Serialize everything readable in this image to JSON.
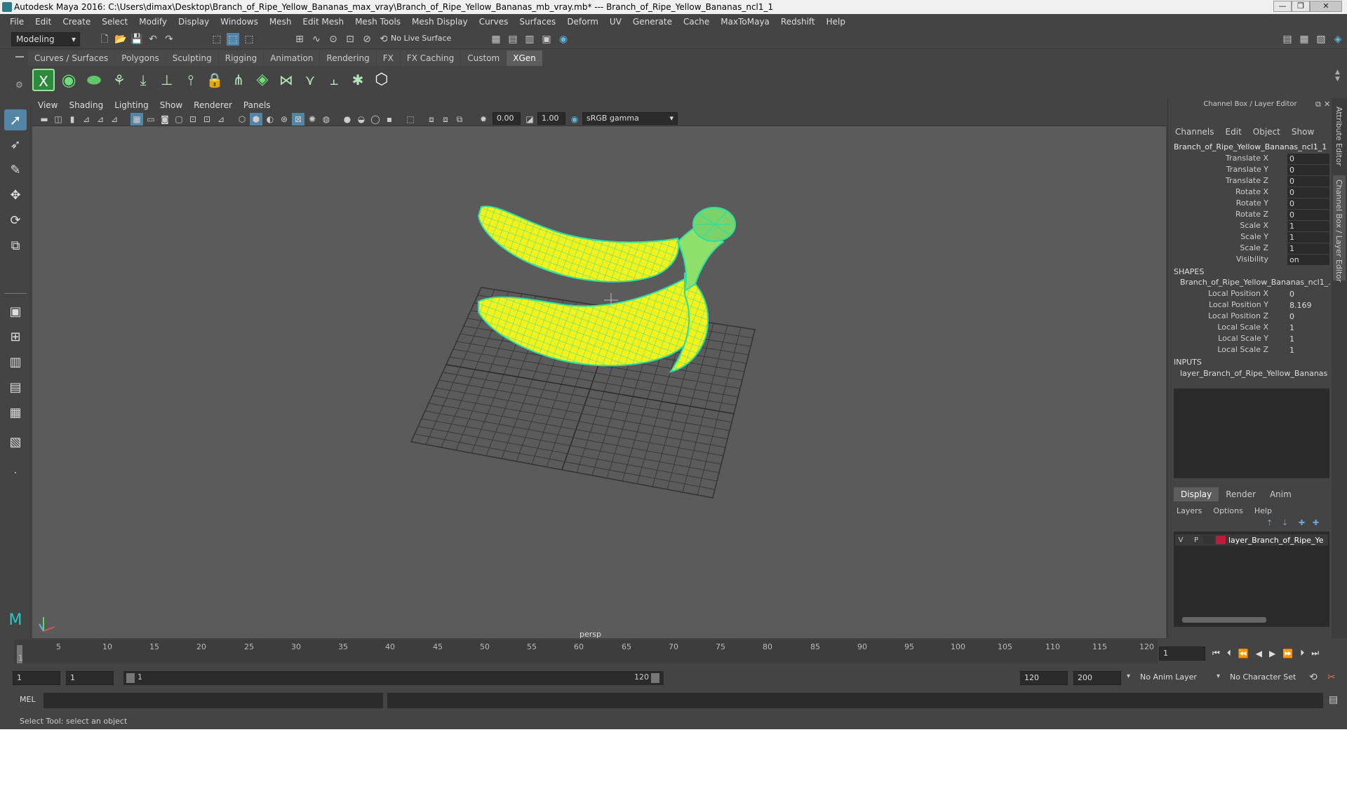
{
  "window": {
    "title": "Autodesk Maya 2016: C:\\Users\\dimax\\Desktop\\Branch_of_Ripe_Yellow_Bananas_max_vray\\Branch_of_Ripe_Yellow_Bananas_mb_vray.mb*   ---   Branch_of_Ripe_Yellow_Bananas_ncl1_1",
    "controls": [
      "—",
      "❐",
      "✕"
    ]
  },
  "menus": [
    "File",
    "Edit",
    "Create",
    "Select",
    "Modify",
    "Display",
    "Windows",
    "Mesh",
    "Edit Mesh",
    "Mesh Tools",
    "Mesh Display",
    "Curves",
    "Surfaces",
    "Deform",
    "UV",
    "Generate",
    "Cache",
    "MaxToMaya",
    "Redshift",
    "Help"
  ],
  "toolbar": {
    "mode": "Modeling",
    "live_surface": "No Live Surface"
  },
  "shelf_tabs": [
    {
      "label": "Curves / Surfaces",
      "active": false
    },
    {
      "label": "Polygons",
      "active": false
    },
    {
      "label": "Sculpting",
      "active": false
    },
    {
      "label": "Rigging",
      "active": false
    },
    {
      "label": "Animation",
      "active": false
    },
    {
      "label": "Rendering",
      "active": false
    },
    {
      "label": "FX",
      "active": false
    },
    {
      "label": "FX Caching",
      "active": false
    },
    {
      "label": "Custom",
      "active": false
    },
    {
      "label": "XGen",
      "active": true
    }
  ],
  "viewport": {
    "menus": [
      "View",
      "Shading",
      "Lighting",
      "Show",
      "Renderer",
      "Panels"
    ],
    "exposure": "0.00",
    "gamma": "1.00",
    "colorspace": "sRGB gamma",
    "camera": "persp"
  },
  "channel_box": {
    "header": "Channel Box / Layer Editor",
    "menus": [
      "Channels",
      "Edit",
      "Object",
      "Show"
    ],
    "object": "Branch_of_Ripe_Yellow_Bananas_ncl1_1",
    "channels": [
      {
        "label": "Translate X",
        "value": "0"
      },
      {
        "label": "Translate Y",
        "value": "0"
      },
      {
        "label": "Translate Z",
        "value": "0"
      },
      {
        "label": "Rotate X",
        "value": "0"
      },
      {
        "label": "Rotate Y",
        "value": "0"
      },
      {
        "label": "Rotate Z",
        "value": "0"
      },
      {
        "label": "Scale X",
        "value": "1"
      },
      {
        "label": "Scale Y",
        "value": "1"
      },
      {
        "label": "Scale Z",
        "value": "1"
      },
      {
        "label": "Visibility",
        "value": "on"
      }
    ],
    "shapes_heading": "SHAPES",
    "shape_name": "Branch_of_Ripe_Yellow_Bananas_ncl1_...",
    "shape_channels": [
      {
        "label": "Local Position X",
        "value": "0"
      },
      {
        "label": "Local Position Y",
        "value": "8.169"
      },
      {
        "label": "Local Position Z",
        "value": "0"
      },
      {
        "label": "Local Scale X",
        "value": "1"
      },
      {
        "label": "Local Scale Y",
        "value": "1"
      },
      {
        "label": "Local Scale Z",
        "value": "1"
      }
    ],
    "inputs_heading": "INPUTS",
    "input_name": "layer_Branch_of_Ripe_Yellow_Bananas"
  },
  "layer_editor": {
    "tabs": [
      "Display",
      "Render",
      "Anim"
    ],
    "menus": [
      "Layers",
      "Options",
      "Help"
    ],
    "layer": {
      "v": "V",
      "p": "P",
      "name": "layer_Branch_of_Ripe_Ye",
      "color": "#c0193a"
    }
  },
  "side_tabs": [
    "Attribute Editor",
    "Channel Box / Layer Editor"
  ],
  "timeline": {
    "ticks": [
      "1",
      "5",
      "10",
      "15",
      "20",
      "25",
      "30",
      "35",
      "40",
      "45",
      "50",
      "55",
      "60",
      "65",
      "70",
      "75",
      "80",
      "85",
      "90",
      "95",
      "100",
      "105",
      "110",
      "115",
      "120"
    ],
    "current_frame": "1"
  },
  "range": {
    "start": "1",
    "playback_start": "1",
    "slider_start": "1",
    "slider_end": "120",
    "playback_end": "120",
    "end": "200",
    "anim_layer": "No Anim Layer",
    "character_set": "No Character Set"
  },
  "command_line": {
    "label": "MEL"
  },
  "status": "Select Tool: select an object",
  "colors": {
    "banana": "#f4f21a",
    "wire": "#29e0a0",
    "accent": "#5285a6"
  }
}
